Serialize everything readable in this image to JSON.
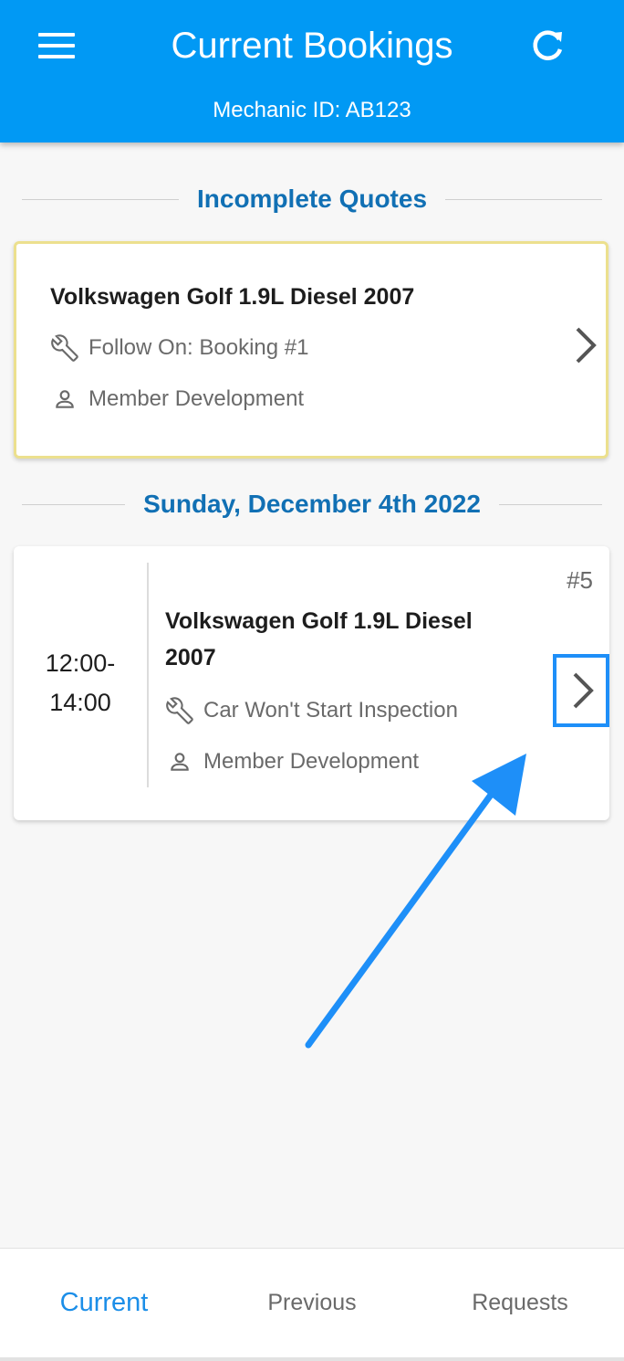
{
  "header": {
    "title": "Current Bookings",
    "subtitle": "Mechanic ID: AB123",
    "menu_icon": "hamburger-menu-icon",
    "refresh_icon": "refresh-icon",
    "background_color": "#0199f4"
  },
  "incomplete_quotes": {
    "heading": "Incomplete Quotes",
    "card": {
      "title": "Volkswagen Golf 1.9L Diesel 2007",
      "service_icon": "wrench-icon",
      "service": "Follow On: Booking #1",
      "member_icon": "person-icon",
      "member": "Member Development",
      "border_color": "#ece08e"
    }
  },
  "day_group": {
    "heading": "Sunday, December 4th 2022",
    "booking": {
      "time_start": "12:00-",
      "time_end": "14:00",
      "number": "#5",
      "title_line1": "Volkswagen Golf 1.9L Diesel",
      "title_line2": "2007",
      "service_icon": "wrench-icon",
      "service": "Car Won't Start Inspection",
      "member_icon": "person-icon",
      "member": "Member Development"
    }
  },
  "annotation": {
    "arrow_color": "#1e8ff8",
    "highlight_color": "#1e8ff8"
  },
  "bottom_nav": {
    "items": [
      {
        "label": "Current",
        "active": true
      },
      {
        "label": "Previous",
        "active": false
      },
      {
        "label": "Requests",
        "active": false
      }
    ],
    "active_color": "#1b8ee8"
  }
}
